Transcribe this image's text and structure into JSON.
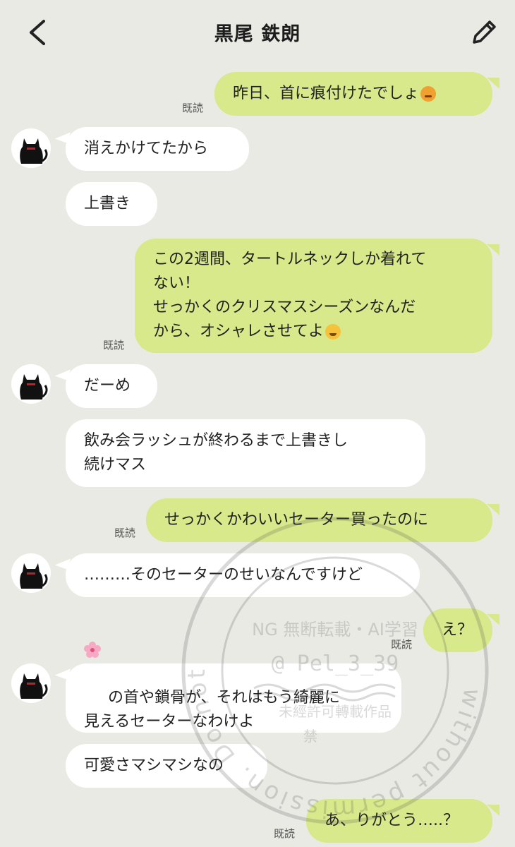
{
  "header": {
    "title": "黒尾 鉄朗",
    "back_icon": "chevron-left-icon",
    "edit_icon": "pencil-icon"
  },
  "read_label": "既読",
  "messages": [
    {
      "side": "out",
      "text": "昨日、首に痕付けたでしょ",
      "emoji": "angry-face",
      "read": true
    },
    {
      "side": "in",
      "text": "消えかけてたから"
    },
    {
      "side": "in",
      "text": "上書き"
    },
    {
      "side": "out",
      "text": "この2週間、タートルネックしか着れて\nない！\nせっかくのクリスマスシーズンなんだ\nから、オシャレさせてよ",
      "emoji": "tired-face",
      "read": true
    },
    {
      "side": "in",
      "text": "だーめ"
    },
    {
      "side": "in",
      "text": "飲み会ラッシュが終わるまで上書きし\n続けマス"
    },
    {
      "side": "out",
      "text": "せっかくかわいいセーター買ったのに",
      "read": true
    },
    {
      "side": "in",
      "text": "………そのセーターのせいなんですけど"
    },
    {
      "side": "out",
      "text": "え？",
      "read": true
    },
    {
      "side": "in",
      "text": "の首や鎖骨が、それはもう綺麗に\n見えるセーターなわけよ",
      "emoji": "cherry-blossom"
    },
    {
      "side": "in",
      "text": "可愛さマシマシなの"
    },
    {
      "side": "out",
      "text": "あ、りがとう…..？",
      "read": true
    }
  ],
  "watermark": {
    "ring_text": "without permission. Do not use my works",
    "line1": "NG 無断転載・AI学習",
    "line2": "@ Pel_3_39",
    "line3": "未經許可轉載作品",
    "line4": "禁"
  },
  "colors": {
    "background": "#eaeae4",
    "incoming": "#ffffff",
    "outgoing": "#d7e98a"
  }
}
